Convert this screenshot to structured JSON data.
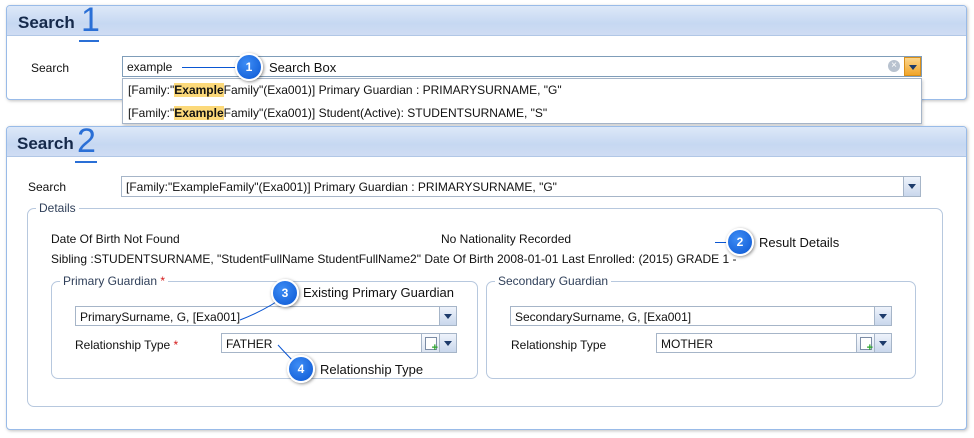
{
  "panel1": {
    "title": "Search",
    "number": "1",
    "search_label": "Search",
    "search_value": "example",
    "callout_number": "1",
    "callout_label": "Search Box",
    "results": [
      {
        "pre": "[Family:\"",
        "highlight": "Example",
        "post": "Family\"(Exa001)] Primary Guardian : PRIMARYSURNAME, \"G\""
      },
      {
        "pre": "[Family:\"",
        "highlight": "Example",
        "post": "Family\"(Exa001)] Student(Active): STUDENTSURNAME, \"S\""
      }
    ]
  },
  "panel2": {
    "title": "Search",
    "number": "2",
    "search_label": "Search",
    "search_value": "[Family:\"ExampleFamily\"(Exa001)] Primary Guardian : PRIMARYSURNAME, \"G\"",
    "details": {
      "legend": "Details",
      "dob": "Date Of Birth Not Found",
      "nationality": "No Nationality Recorded",
      "sibling": "Sibling :STUDENTSURNAME, \"StudentFullName StudentFullName2\" Date Of Birth 2008-01-01 Last Enrolled: (2015) GRADE 1 -",
      "callout_number": "2",
      "callout_label": "Result Details"
    },
    "primary": {
      "legend": "Primary Guardian",
      "required_mark": "*",
      "guardian_value": "PrimarySurname, G, [Exa001]",
      "relationship_label": "Relationship Type",
      "relationship_value": "FATHER",
      "callout3_number": "3",
      "callout3_label": "Existing Primary Guardian",
      "callout4_number": "4",
      "callout4_label": "Relationship Type"
    },
    "secondary": {
      "legend": "Secondary Guardian",
      "guardian_value": "SecondarySurname, G, [Exa001]",
      "relationship_label": "Relationship Type",
      "relationship_value": "MOTHER"
    }
  },
  "colors": {
    "accent": "#2a6fd6",
    "callout": "#0a56d2",
    "highlight": "#fcd97a",
    "header": "#c6d8f2",
    "required": "#d41a1a"
  },
  "icons": [
    "clear-icon",
    "chevron-down-icon",
    "add-icon"
  ]
}
